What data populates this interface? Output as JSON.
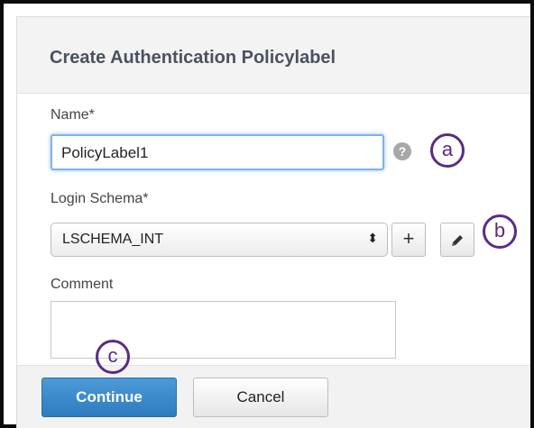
{
  "dialog": {
    "title": "Create Authentication Policylabel"
  },
  "form": {
    "name_label": "Name*",
    "name_value": "PolicyLabel1",
    "help_icon": "question-circle-icon",
    "help_glyph": "?",
    "login_schema_label": "Login Schema*",
    "login_schema_value": "LSCHEMA_INT",
    "select_glyph": "⬍",
    "add_glyph": "+",
    "edit_icon": "pencil-icon",
    "comment_label": "Comment",
    "comment_value": ""
  },
  "callouts": {
    "a": "a",
    "b": "b",
    "c": "c"
  },
  "footer": {
    "continue_label": "Continue",
    "cancel_label": "Cancel"
  },
  "colors": {
    "callout": "#5b2a86",
    "primary_button": "#2e7bbf",
    "input_focus": "#7db3e8"
  }
}
